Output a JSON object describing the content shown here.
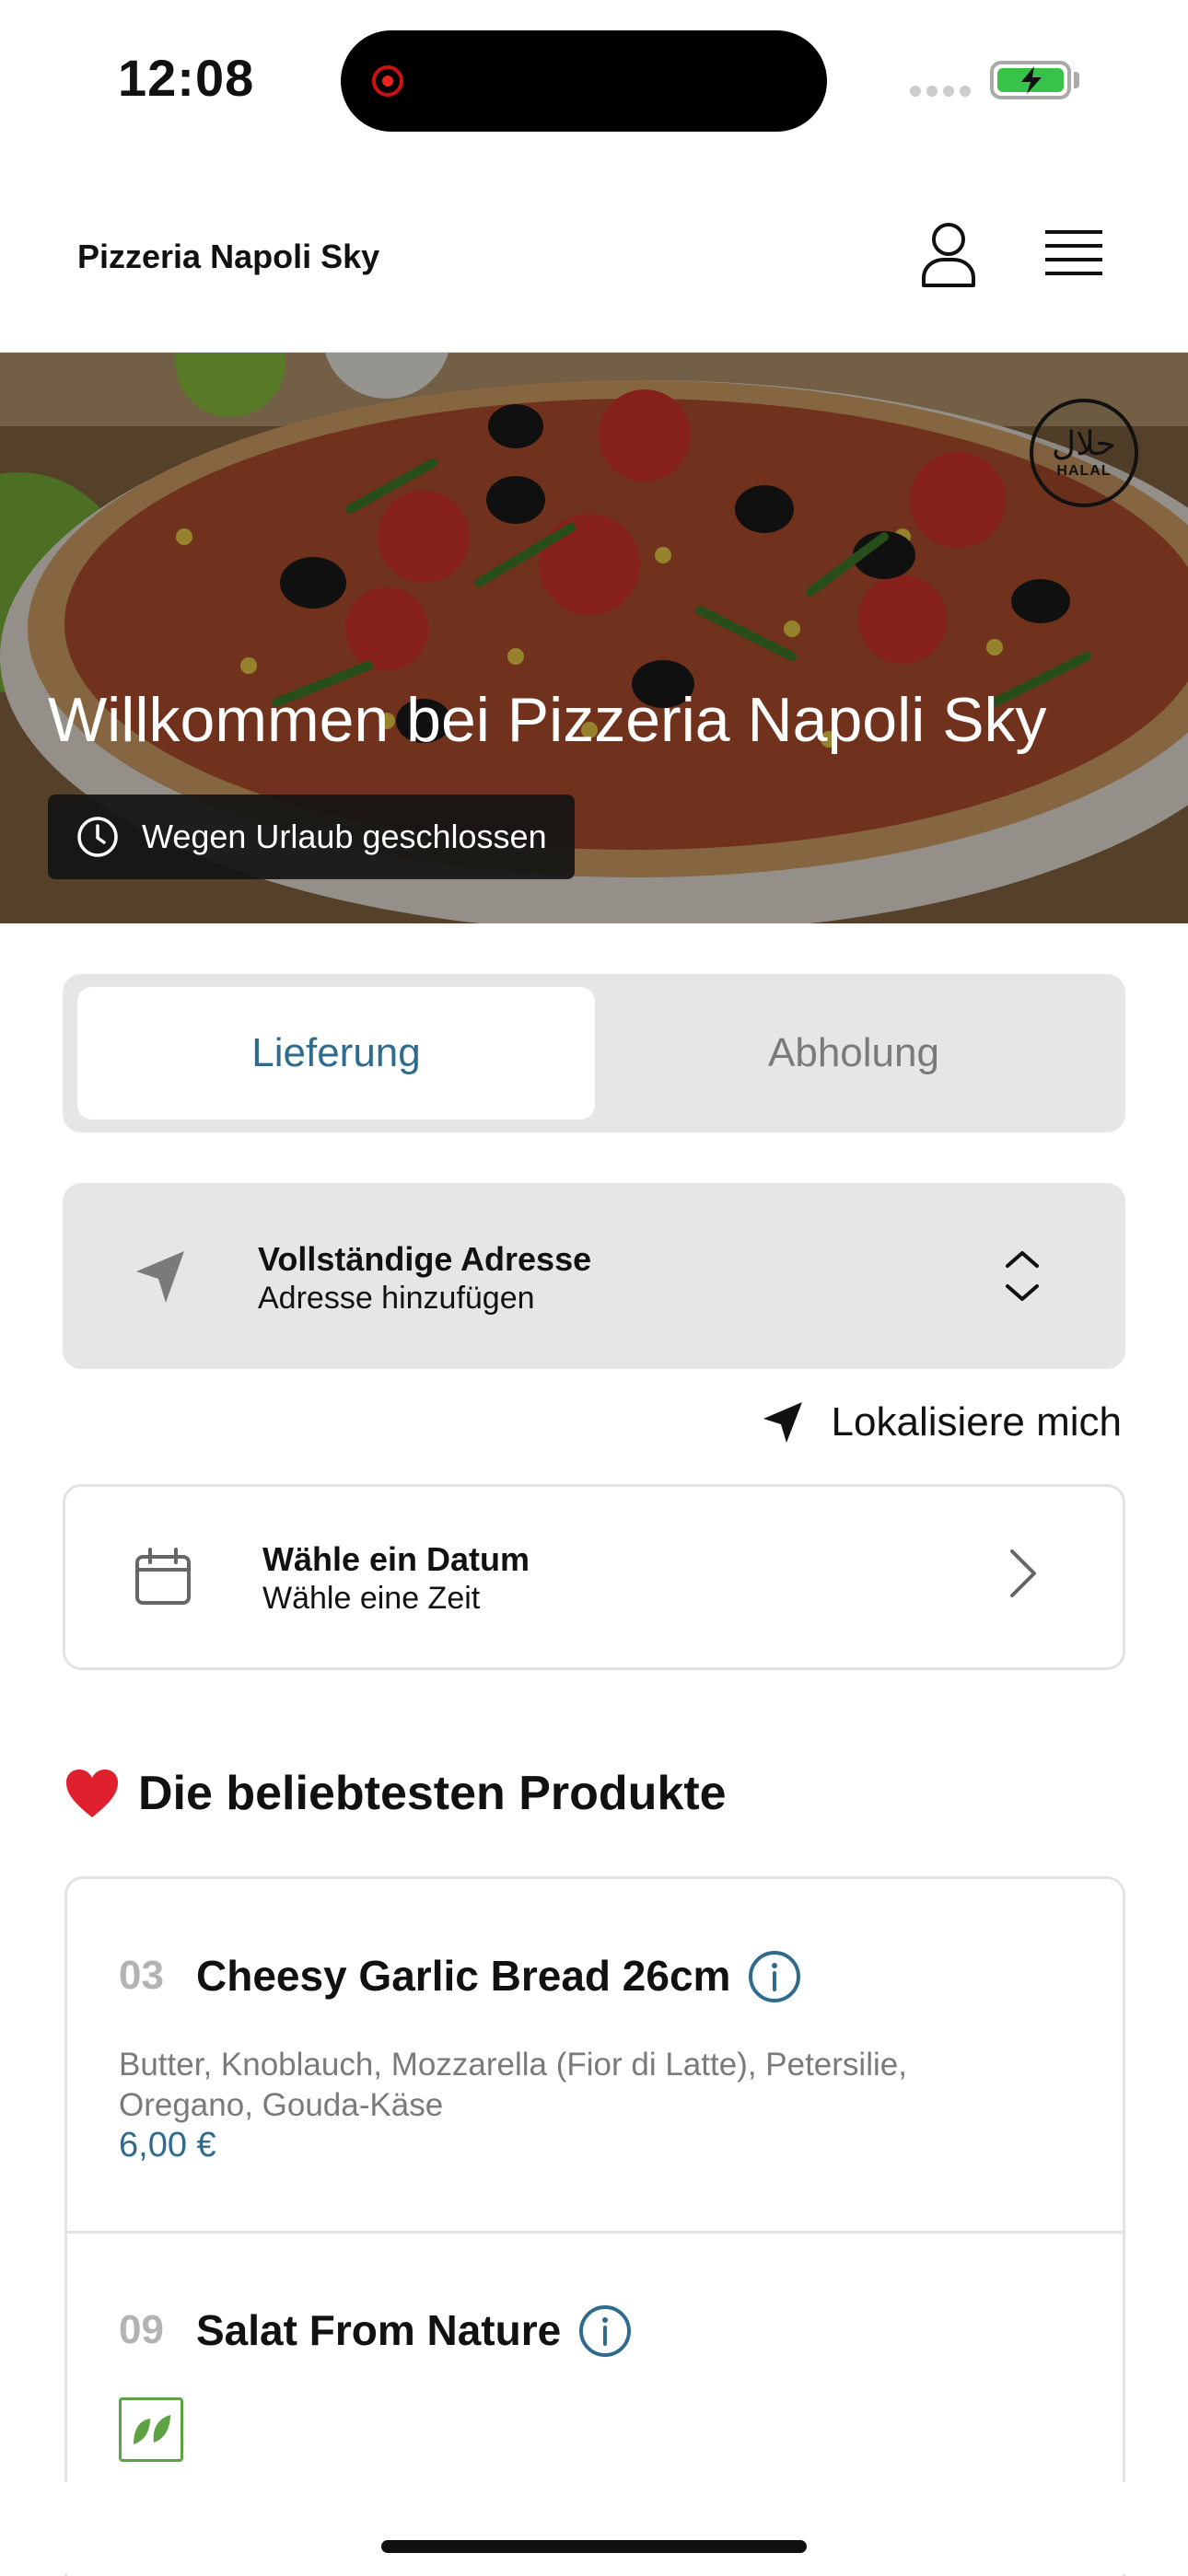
{
  "status_bar": {
    "time": "12:08"
  },
  "header": {
    "brand": "Pizzeria Napoli Sky"
  },
  "hero": {
    "title": "Willkommen bei Pizzeria Napoli Sky",
    "status": "Wegen Urlaub geschlossen",
    "halal_arabic": "حلال",
    "halal_label": "HALAL"
  },
  "mode": {
    "delivery": "Lieferung",
    "pickup": "Abholung",
    "selected": "delivery"
  },
  "address": {
    "title": "Vollständige Adresse",
    "subtitle": "Adresse hinzufügen"
  },
  "locate": {
    "label": "Lokalisiere mich"
  },
  "date": {
    "title": "Wähle ein Datum",
    "subtitle": "Wähle eine Zeit"
  },
  "popular": {
    "title": "Die beliebtesten Produkte",
    "products": [
      {
        "number": "03",
        "name": "Cheesy Garlic Bread 26cm",
        "description": "Butter, Knoblauch, Mozzarella (Fior di Latte), Petersilie, Oregano, Gouda-Käse",
        "price": "6,00 €"
      },
      {
        "number": "09",
        "name": "Salat From Nature"
      }
    ]
  },
  "colors": {
    "accent": "#2e6b8c",
    "veg": "#5ea343",
    "panel": "#e6e6e6"
  }
}
